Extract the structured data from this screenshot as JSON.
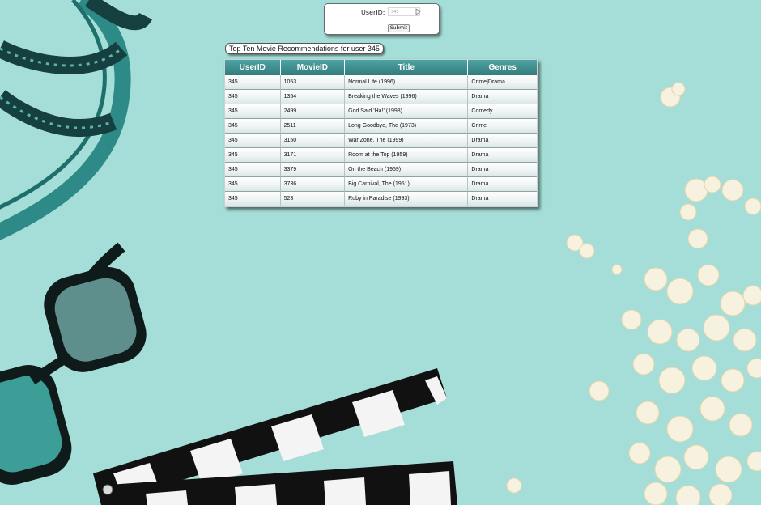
{
  "form": {
    "userid_label": "UserID:",
    "userid_value": "345",
    "submit_label": "Submit"
  },
  "recommendations": {
    "title": "Top Ten Movie Recommendations for user 345",
    "columns": [
      "UserID",
      "MovieID",
      "Title",
      "Genres"
    ],
    "rows": [
      [
        "345",
        "1053",
        "Normal Life (1996)",
        "Crime|Drama"
      ],
      [
        "345",
        "1354",
        "Breaking the Waves (1996)",
        "Drama"
      ],
      [
        "345",
        "2499",
        "God Said 'Ha!' (1998)",
        "Comedy"
      ],
      [
        "345",
        "2511",
        "Long Goodbye, The (1973)",
        "Crime"
      ],
      [
        "345",
        "3150",
        "War Zone, The (1999)",
        "Drama"
      ],
      [
        "345",
        "3171",
        "Room at the Top (1959)",
        "Drama"
      ],
      [
        "345",
        "3379",
        "On the Beach (1959)",
        "Drama"
      ],
      [
        "345",
        "3736",
        "Big Carnival, The (1951)",
        "Drama"
      ],
      [
        "345",
        "523",
        "Ruby in Paradise (1993)",
        "Drama"
      ]
    ]
  },
  "background": {
    "color": "#a5ded8",
    "icons": [
      "film-reel-icon",
      "3d-glasses-icon",
      "clapperboard-icon",
      "popcorn-icon"
    ]
  },
  "colors": {
    "table_header": "#3f8d8d",
    "table_header_text": "#ffffff"
  }
}
